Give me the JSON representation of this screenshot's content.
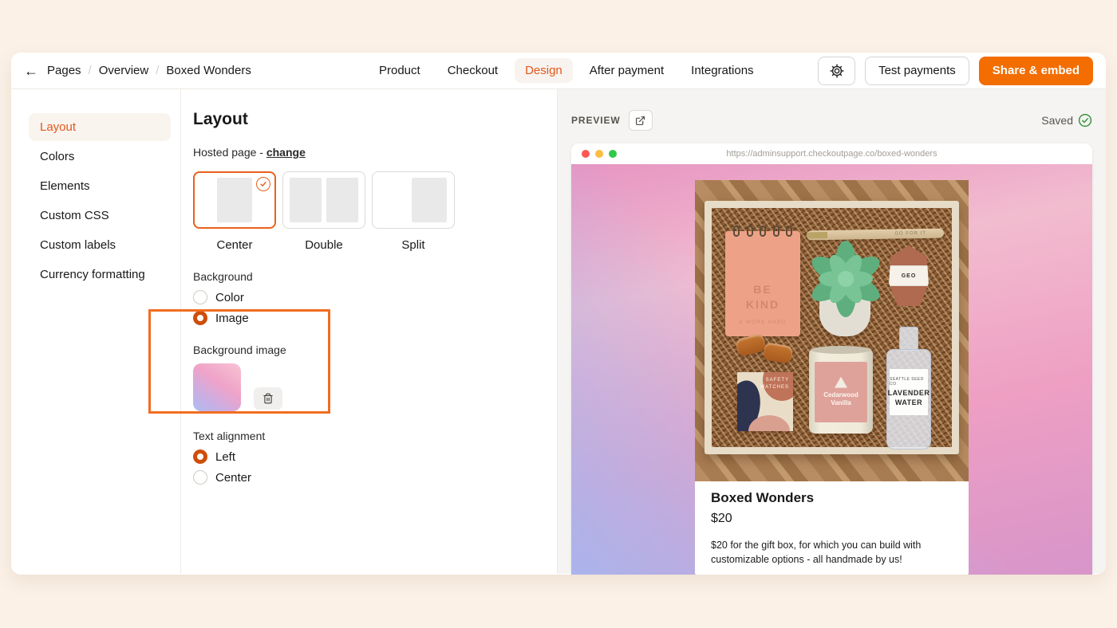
{
  "topbar": {
    "breadcrumb": {
      "separator": "/",
      "back_icon": "arrow-left",
      "items": [
        "Pages",
        "Overview",
        "Boxed Wonders"
      ]
    },
    "tabs": [
      {
        "label": "Product",
        "active": false
      },
      {
        "label": "Checkout",
        "active": false
      },
      {
        "label": "Design",
        "active": true
      },
      {
        "label": "After payment",
        "active": false
      },
      {
        "label": "Integrations",
        "active": false
      }
    ],
    "actions": {
      "settings_icon": "gear-icon",
      "test_payments_label": "Test payments",
      "share_embed_label": "Share & embed"
    }
  },
  "sidebar": {
    "items": [
      {
        "label": "Layout",
        "active": true
      },
      {
        "label": "Colors",
        "active": false
      },
      {
        "label": "Elements",
        "active": false
      },
      {
        "label": "Custom CSS",
        "active": false
      },
      {
        "label": "Custom labels",
        "active": false
      },
      {
        "label": "Currency formatting",
        "active": false
      }
    ]
  },
  "editor": {
    "title": "Layout",
    "hosted_page": {
      "prefix": "Hosted page -",
      "link": "change"
    },
    "layout_options": [
      {
        "label": "Center",
        "selected": true
      },
      {
        "label": "Double",
        "selected": false
      },
      {
        "label": "Split",
        "selected": false
      }
    ],
    "background": {
      "label": "Background",
      "options": [
        {
          "label": "Color",
          "selected": false
        },
        {
          "label": "Image",
          "selected": true
        }
      ]
    },
    "background_image": {
      "label": "Background image",
      "delete_icon": "trash-icon"
    },
    "text_alignment": {
      "label": "Text alignment",
      "options": [
        {
          "label": "Left",
          "selected": true
        },
        {
          "label": "Center",
          "selected": false
        }
      ]
    }
  },
  "preview": {
    "label": "PREVIEW",
    "open_icon": "external-link-icon",
    "saved_label": "Saved",
    "saved_icon": "check-circle-icon",
    "url": "https://adminsupport.checkoutpage.co/boxed-wonders",
    "product": {
      "name": "Boxed Wonders",
      "price": "$20",
      "description": "$20 for the gift box, for which you can build with customizable options - all handmade by us!"
    },
    "photo": {
      "notepad_line1": "BE",
      "notepad_line2": "KIND",
      "notepad_line3": "& WORK HARD",
      "pen_label": "GO FOR IT",
      "soap_label": "GEO",
      "matches_line1": "SAFETY",
      "matches_line2": "MATCHES",
      "candle_line1": "Cedarwood",
      "candle_line2": "Vanilla",
      "spray_brand": "SEATTLE SEED CO",
      "spray_line1": "LAVENDER",
      "spray_line2": "WATER"
    }
  },
  "colors": {
    "page_background": "#fbf1e7",
    "accent_orange": "#e2571c",
    "primary_button_orange": "#f36d00",
    "annotation_border_orange": "#f26d21",
    "saved_green": "#3f9142",
    "traffic_lights": [
      "#fc5753",
      "#fdbc40",
      "#33c748"
    ],
    "preview_gradient": [
      "#e795c2",
      "#f2bccf",
      "#ee9fc3",
      "#d795ca",
      "#aab4ec"
    ]
  }
}
